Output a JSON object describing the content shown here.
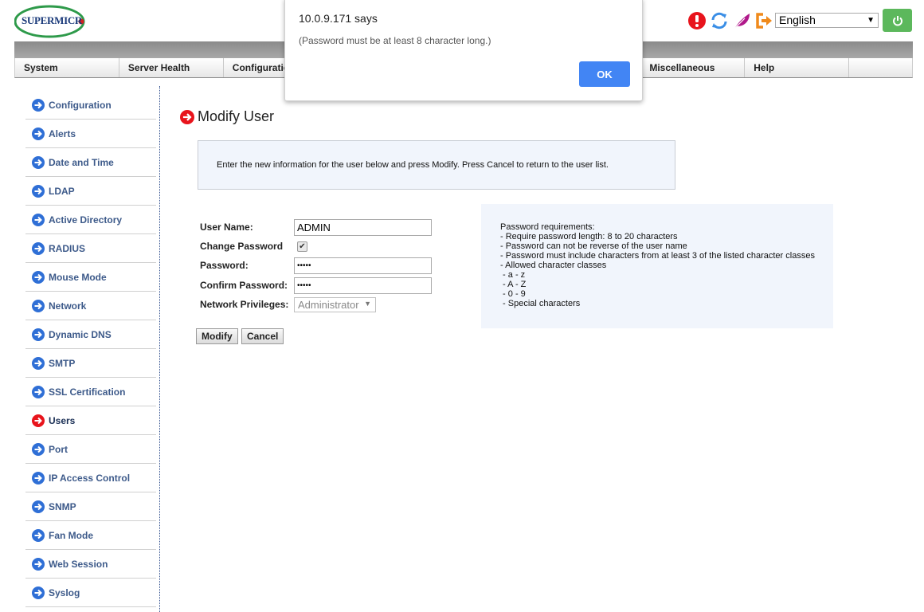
{
  "header": {
    "logo_text": "SUPERMICR",
    "icons": [
      "alert-icon",
      "refresh-icon",
      "feather-icon",
      "logout-icon"
    ],
    "language": "English",
    "power_icon": "power-icon"
  },
  "nav": {
    "items": [
      "System",
      "Server Health",
      "Configuration",
      "",
      "",
      "",
      "Miscellaneous",
      "Help",
      ""
    ]
  },
  "sidebar": {
    "active": "Users",
    "items": [
      {
        "label": "Configuration"
      },
      {
        "label": "Alerts"
      },
      {
        "label": "Date and Time"
      },
      {
        "label": "LDAP"
      },
      {
        "label": "Active Directory"
      },
      {
        "label": "RADIUS"
      },
      {
        "label": "Mouse Mode"
      },
      {
        "label": "Network"
      },
      {
        "label": "Dynamic DNS"
      },
      {
        "label": "SMTP"
      },
      {
        "label": "SSL Certification"
      },
      {
        "label": "Users"
      },
      {
        "label": "Port"
      },
      {
        "label": "IP Access Control"
      },
      {
        "label": "SNMP"
      },
      {
        "label": "Fan Mode"
      },
      {
        "label": "Web Session"
      },
      {
        "label": "Syslog"
      }
    ]
  },
  "main": {
    "title": "Modify User",
    "info": "Enter the new information for the user below and press Modify. Press Cancel to return to the user list.",
    "form": {
      "username_label": "User Name:",
      "username_value": "ADMIN",
      "change_password_label": "Change Password",
      "change_password_checked": true,
      "password_label": "Password:",
      "password_value": "•••••",
      "confirm_label": "Confirm Password:",
      "confirm_value": "•••••",
      "privileges_label": "Network Privileges:",
      "privileges_value": "Administrator"
    },
    "modify_label": "Modify",
    "cancel_label": "Cancel",
    "requirements": [
      "Password requirements:",
      "- Require password length: 8 to 20 characters",
      "- Password can not be reverse of the user name",
      "- Password must include characters from at least 3 of the listed character classes",
      "- Allowed character classes",
      " - a - z",
      " - A - Z",
      " - 0 - 9",
      " - Special characters"
    ]
  },
  "dialog": {
    "title": "10.0.9.171 says",
    "message": "(Password must be at least 8 character long.)",
    "ok_label": "OK",
    "ok_color": "#4285f4"
  }
}
